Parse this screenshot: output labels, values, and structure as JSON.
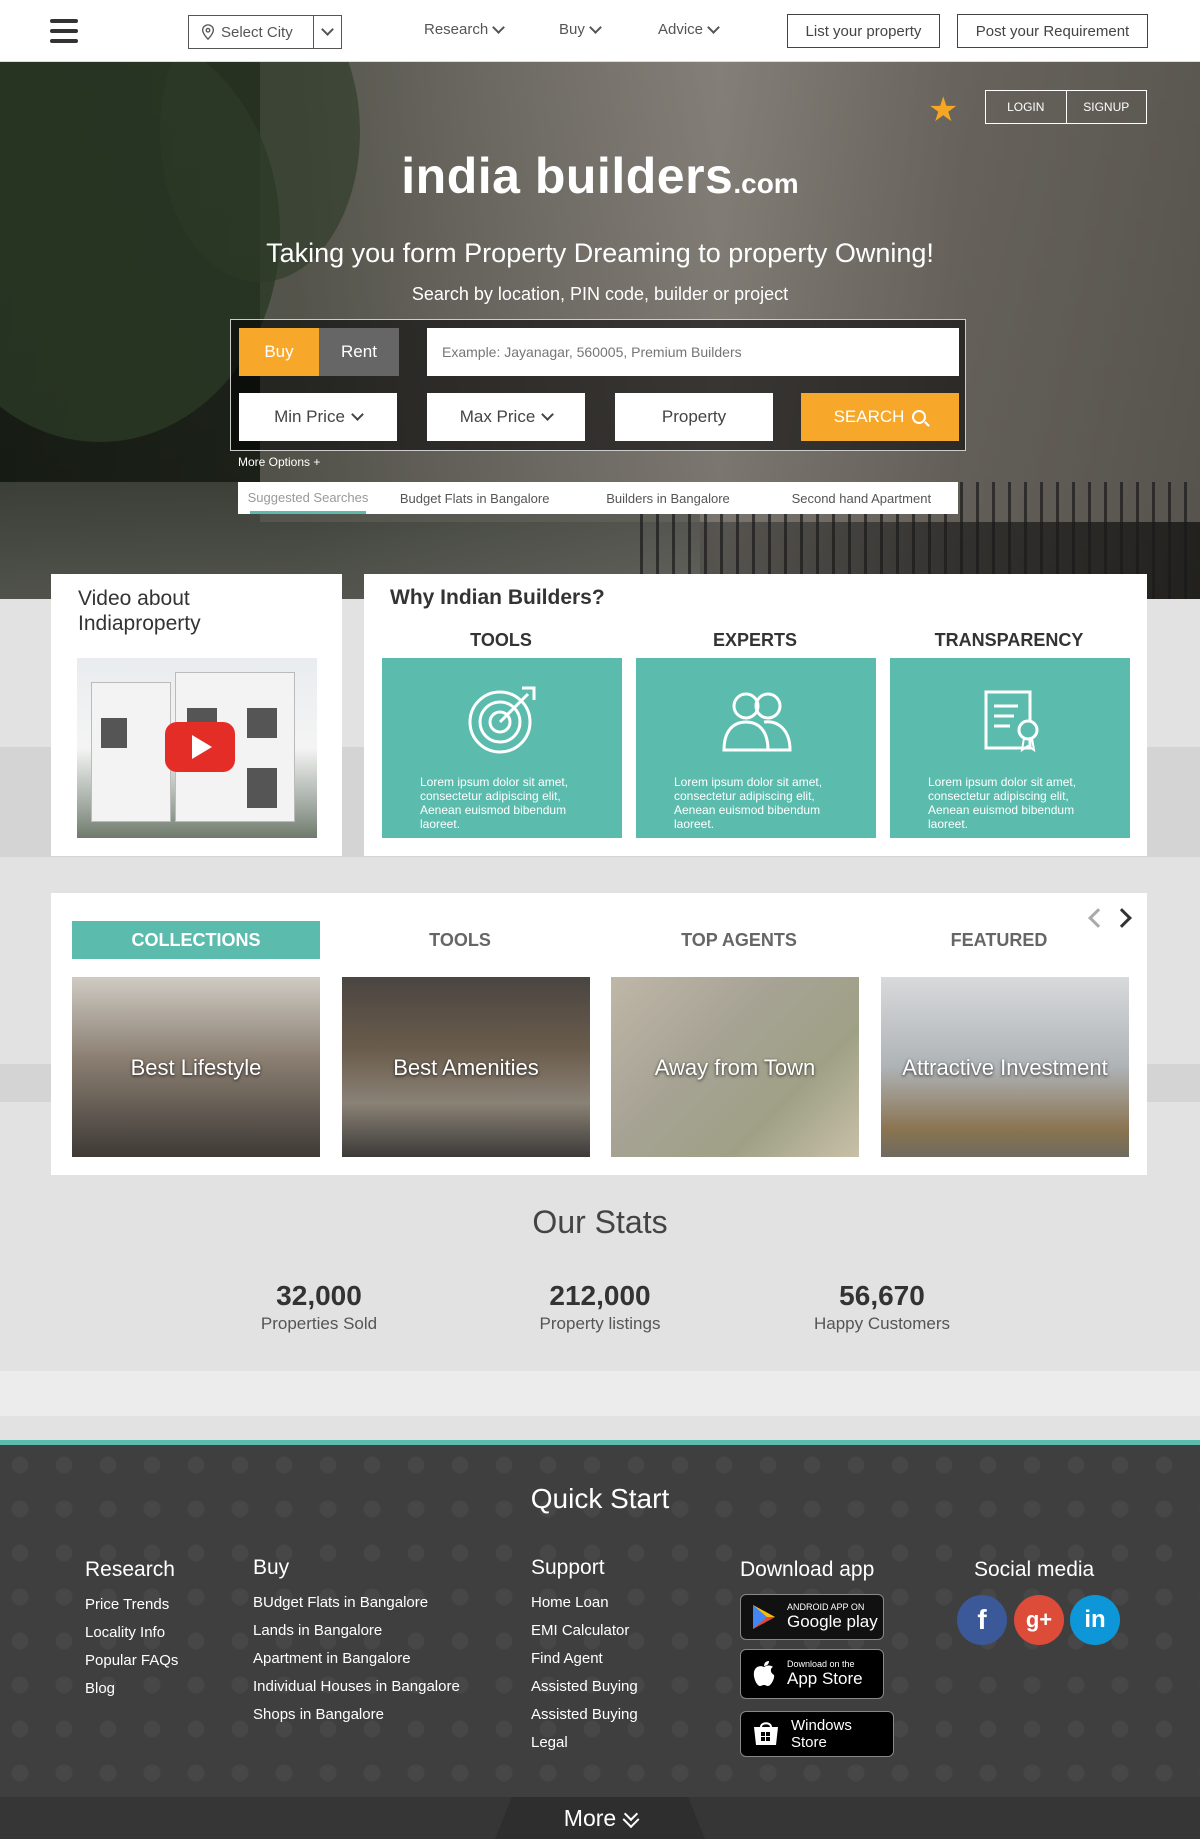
{
  "nav": {
    "city": "Select City",
    "links": [
      "Research",
      "Buy",
      "Advice"
    ],
    "list_property": "List your property",
    "post_requirement": "Post your Requirement"
  },
  "hero": {
    "login": "LOGIN",
    "signup": "SIGNUP",
    "logo_main": "india builders",
    "logo_suffix": ".com",
    "tagline": "Taking you form Property Dreaming to property Owning!",
    "subtagline": "Search by location, PIN code,  builder or project",
    "tab_buy": "Buy",
    "tab_rent": "Rent",
    "search_placeholder": "Example: Jayanagar, 560005, Premium Builders",
    "min_price": "Min Price",
    "max_price": "Max Price",
    "property": "Property",
    "search_button": "SEARCH",
    "more_options": "More Options +",
    "suggested_label": "Suggested Searches",
    "suggestions": [
      "Budget Flats in Bangalore",
      "Builders in Bangalore",
      "Second hand Apartment"
    ]
  },
  "video": {
    "title": "Video about Indiaproperty"
  },
  "why": {
    "title": "Why Indian Builders?",
    "items": [
      {
        "heading": "TOOLS",
        "icon": "target-icon",
        "text": "Lorem ipsum dolor sit amet, consectetur adipiscing elit, Aenean euismod bibendum laoreet."
      },
      {
        "heading": "EXPERTS",
        "icon": "people-icon",
        "text": "Lorem ipsum dolor sit amet, consectetur adipiscing elit, Aenean euismod bibendum laoreet."
      },
      {
        "heading": "TRANSPARENCY",
        "icon": "certificate-icon",
        "text": "Lorem ipsum dolor sit amet, consectetur adipiscing elit, Aenean euismod bibendum laoreet."
      }
    ]
  },
  "collections": {
    "tabs": [
      "COLLECTIONS",
      "TOOLS",
      "TOP AGENTS",
      "FEATURED"
    ],
    "tiles": [
      "Best Lifestyle",
      "Best Amenities",
      "Away from Town",
      "Attractive Investment"
    ]
  },
  "stats": {
    "title": "Our Stats",
    "items": [
      {
        "value": "32,000",
        "label": "Properties Sold"
      },
      {
        "value": "212,000",
        "label": "Property listings"
      },
      {
        "value": "56,670",
        "label": "Happy Customers"
      }
    ]
  },
  "footer": {
    "title": "Quick Start",
    "research": {
      "heading": "Research",
      "items": [
        "Price Trends",
        "Locality Info",
        "Popular FAQs",
        "Blog"
      ]
    },
    "buy": {
      "heading": "Buy",
      "items": [
        "BUdget Flats in Bangalore",
        "Lands in Bangalore",
        "Apartment in Bangalore",
        "Individual Houses in Bangalore",
        "Shops in Bangalore"
      ]
    },
    "support": {
      "heading": "Support",
      "items": [
        "Home Loan",
        "EMI Calculator",
        "Find Agent",
        "Assisted Buying",
        "Assisted Buying",
        "Legal"
      ]
    },
    "download": {
      "heading": "Download app",
      "google_small": "ANDROID APP ON",
      "google_big": "Google play",
      "apple_small": "Download on the",
      "apple_big": "App Store",
      "windows_big": "Windows",
      "windows_small": "Store"
    },
    "social": {
      "heading": "Social media",
      "icons": [
        "facebook-icon",
        "google-plus-icon",
        "linkedin-icon"
      ]
    },
    "more": "More"
  },
  "colors": {
    "accent": "#5bbcad",
    "orange": "#f7a82b",
    "footer": "#3f3f3f"
  }
}
